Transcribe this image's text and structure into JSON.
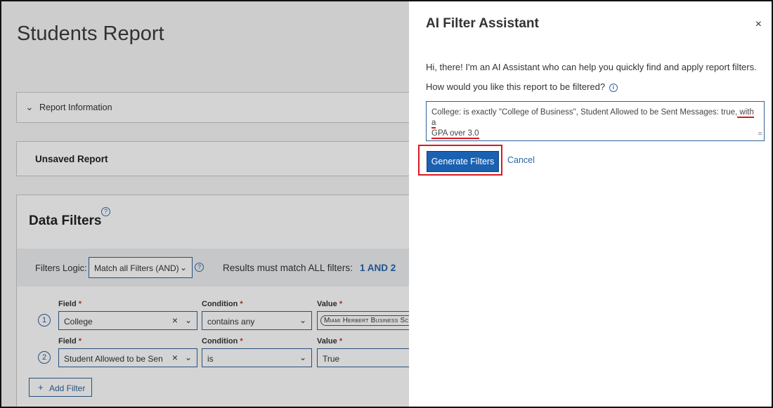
{
  "report": {
    "title": "Students Report",
    "report_info_label": "Report Information",
    "unsaved_label": "Unsaved Report",
    "data_filters_title": "Data Filters",
    "filters_logic_label": "Filters Logic:",
    "filters_logic_value": "Match all Filters (AND)",
    "results_text": "Results must match ALL filters:",
    "logic_expression": "1 AND 2",
    "field_header": "Field",
    "condition_header": "Condition",
    "value_header": "Value",
    "required_mark": "*",
    "filters": [
      {
        "num": "1",
        "field": "College",
        "condition": "contains any",
        "value": "Miami Herbert Business Scho"
      },
      {
        "num": "2",
        "field": "Student Allowed to be Sent M",
        "condition": "is",
        "value": "True"
      }
    ],
    "add_filter_label": "Add Filter"
  },
  "assistant": {
    "title": "AI Filter Assistant",
    "close_glyph": "×",
    "intro": "Hi, there! I'm an AI Assistant who can help you quickly find and apply report filters.",
    "question": "How would you like this report to be filtered?",
    "prompt_text_plain": "College: is exactly \"College of Business\", Student Allowed to be Sent Messages: true,",
    "prompt_text_highlight_1": " with a",
    "prompt_text_highlight_2": "GPA over 3.0",
    "generate_label": "Generate Filters",
    "cancel_label": "Cancel"
  },
  "colors": {
    "accent": "#1b61b1",
    "highlight_border": "#d71920",
    "link": "#2a65a8"
  },
  "icons": [
    "chevron-down-icon",
    "help-icon",
    "info-icon",
    "close-icon",
    "clear-icon",
    "plus-icon"
  ]
}
